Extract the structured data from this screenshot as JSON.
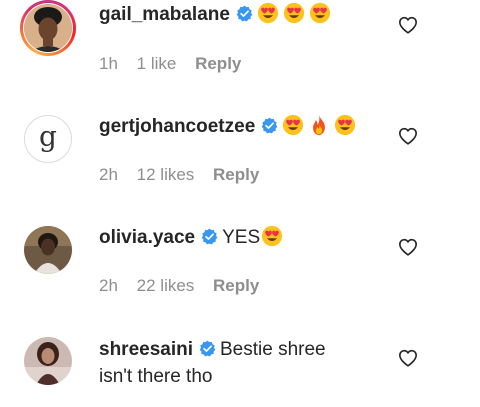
{
  "comments": [
    {
      "username": "gail_mabalane",
      "verified": true,
      "text": "",
      "emojis": [
        "heart-eyes",
        "heart-eyes",
        "heart-eyes"
      ],
      "time": "1h",
      "likes": "1 like",
      "reply_label": "Reply",
      "has_story_ring": true
    },
    {
      "username": "gertjohancoetzee",
      "verified": true,
      "text": "",
      "emojis": [
        "heart-eyes",
        "fire",
        "heart-eyes"
      ],
      "time": "2h",
      "likes": "12 likes",
      "reply_label": "Reply",
      "avatar_letter": "g"
    },
    {
      "username": "olivia.yace",
      "verified": true,
      "text": "YES",
      "emojis": [
        "heart-eyes"
      ],
      "time": "2h",
      "likes": "22 likes",
      "reply_label": "Reply"
    },
    {
      "username": "shreesaini",
      "verified": true,
      "text": "Bestie shree",
      "text_cont": "isn't there tho"
    }
  ],
  "colors": {
    "verified_blue": "#3897f0",
    "meta_gray": "#8e8e8e",
    "text": "#262626"
  },
  "icons": {
    "like": "heart-outline-icon",
    "verified": "verified-badge-icon"
  }
}
